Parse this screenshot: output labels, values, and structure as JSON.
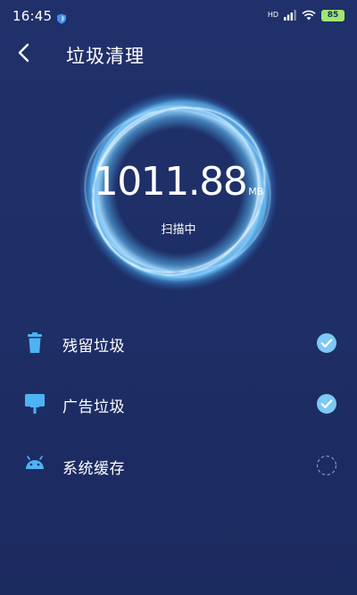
{
  "status_bar": {
    "time": "16:45",
    "network_label": "HD",
    "battery": "85",
    "shield_icon": "shield-icon",
    "signal_icon": "signal-icon",
    "wifi_icon": "wifi-icon"
  },
  "header": {
    "title": "垃圾清理",
    "back_icon": "chevron-left-icon"
  },
  "scan": {
    "size_value": "1011.88",
    "size_unit": "MB",
    "status": "扫描中",
    "ring_icon": "glowing-ring"
  },
  "items": [
    {
      "label": "残留垃圾",
      "icon": "trash-icon",
      "status": "done"
    },
    {
      "label": "广告垃圾",
      "icon": "billboard-icon",
      "status": "done"
    },
    {
      "label": "系统缓存",
      "icon": "android-icon",
      "status": "scanning"
    }
  ],
  "colors": {
    "background": "#1f2f66",
    "accent": "#4db3f2",
    "check": "#7dc8f5",
    "battery": "#9fe870"
  }
}
